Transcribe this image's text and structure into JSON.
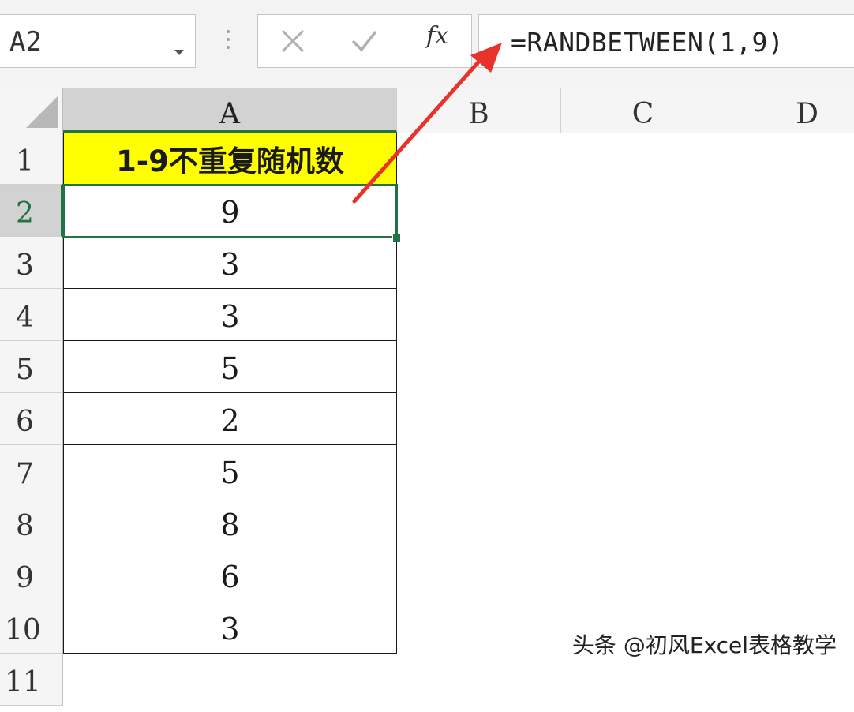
{
  "formula_bar": {
    "name_box": "A2",
    "fx_label": "fx",
    "formula": "=RANDBETWEEN(1,9)"
  },
  "columns": [
    "A",
    "B",
    "C",
    "D"
  ],
  "rows": [
    "1",
    "2",
    "3",
    "4",
    "5",
    "6",
    "7",
    "8",
    "9",
    "10",
    "11"
  ],
  "cells": {
    "A1": "1-9不重复随机数",
    "A2": "9",
    "A3": "3",
    "A4": "3",
    "A5": "5",
    "A6": "2",
    "A7": "5",
    "A8": "8",
    "A9": "6",
    "A10": "3"
  },
  "selection": {
    "active_cell": "A2"
  },
  "colors": {
    "header_fill": "#ffff00",
    "selection": "#217346",
    "arrow": "#e8332a"
  },
  "icons": {
    "cancel": "cancel-x-icon",
    "enter": "enter-check-icon",
    "name_box_dropdown": "chevron-down-icon"
  },
  "watermark": "头条 @初风Excel表格教学"
}
